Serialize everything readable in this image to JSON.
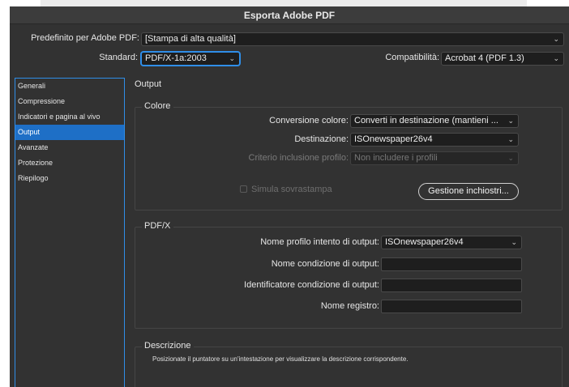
{
  "window": {
    "title": "Esporta Adobe PDF"
  },
  "header": {
    "preset_label": "Predefinito per Adobe PDF:",
    "preset_value": "[Stampa di alta qualità]",
    "standard_label": "Standard:",
    "standard_value": "PDF/X-1a:2003",
    "compat_label": "Compatibilità:",
    "compat_value": "Acrobat 4 (PDF 1.3)"
  },
  "sidebar": {
    "items": [
      {
        "label": "Generali"
      },
      {
        "label": "Compressione"
      },
      {
        "label": "Indicatori e pagina al vivo"
      },
      {
        "label": "Output"
      },
      {
        "label": "Avanzate"
      },
      {
        "label": "Protezione"
      },
      {
        "label": "Riepilogo"
      }
    ],
    "active_index": 3
  },
  "main": {
    "section_title": "Output",
    "color_group": {
      "title": "Colore",
      "conversion_label": "Conversione colore:",
      "conversion_value": "Converti in destinazione (mantieni ...",
      "destination_label": "Destinazione:",
      "destination_value": "ISOnewspaper26v4",
      "profile_label": "Criterio inclusione profilo:",
      "profile_value": "Non includere i profili",
      "simulate_label": "Simula sovrastampa",
      "ink_button": "Gestione inchiostri..."
    },
    "pdfx_group": {
      "title": "PDF/X",
      "intent_label": "Nome profilo intento di output:",
      "intent_value": "ISOnewspaper26v4",
      "condition_name_label": "Nome condizione di output:",
      "condition_name_value": "",
      "condition_id_label": "Identificatore condizione di output:",
      "condition_id_value": "",
      "registry_label": "Nome registro:",
      "registry_value": ""
    },
    "description_group": {
      "title": "Descrizione",
      "text": "Posizionate il puntatore su un'intestazione per visualizzare la descrizione corrispondente."
    }
  },
  "icons": {
    "dropdown": "chevron-down-icon",
    "checkbox": "checkbox-icon"
  },
  "colors": {
    "dialog_bg": "#323232",
    "accent": "#2f8ee8",
    "selection": "#1e6fc6",
    "field_bg": "#1e1e1e"
  }
}
